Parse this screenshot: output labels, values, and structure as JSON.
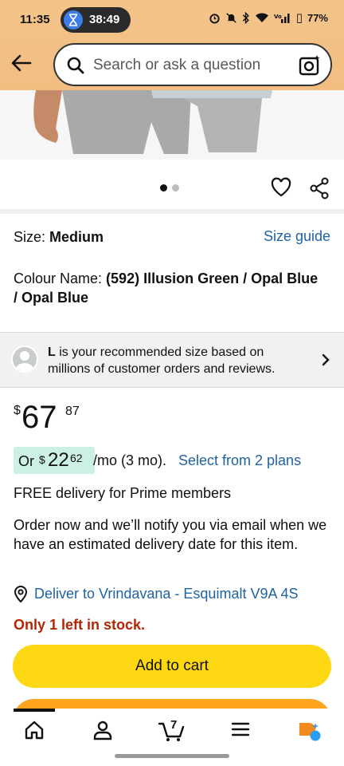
{
  "status_bar": {
    "time": "11:35",
    "timer": "38:49",
    "battery": "77%",
    "icons": [
      "alarm-icon",
      "mute-icon",
      "bluetooth-icon",
      "wifi-icon",
      "signal-icon",
      "battery-icon"
    ]
  },
  "search": {
    "placeholder": "Search or ask a question"
  },
  "gallery": {
    "dot_count": 2,
    "active_index": 0
  },
  "size": {
    "label": "Size: ",
    "value": "Medium",
    "guide_link": "Size guide"
  },
  "colour": {
    "label": "Colour Name: ",
    "value": "(592) Illusion Green / Opal Blue / Opal Blue"
  },
  "recommendation": {
    "size_letter": "L",
    "text": " is your recommended size based on millions of customer orders and reviews."
  },
  "price": {
    "currency": "$",
    "whole": "67",
    "fraction": "87"
  },
  "installment": {
    "prefix": "Or",
    "currency": "$",
    "whole": "22",
    "fraction": "62",
    "suffix": "/mo (3 mo).",
    "link": "Select from 2 plans"
  },
  "delivery": {
    "free_text": "FREE delivery for Prime members",
    "order_note": "Order now and we’ll notify you via email when we have an estimated delivery date for this item.",
    "deliver_to": "Deliver to Vrindavana - Esquimalt V9A 4S"
  },
  "stock": {
    "text": "Only 1 left in stock."
  },
  "actions": {
    "add_to_cart": "Add to cart"
  },
  "bottom_nav": {
    "cart_count": "7",
    "items": [
      "home-icon",
      "account-icon",
      "cart-icon",
      "menu-icon",
      "rufus-icon"
    ]
  },
  "colors": {
    "accent_link": "#2162a1",
    "cart_button": "#ffd814",
    "buy_button": "#ffa41c",
    "stock_red": "#b12704",
    "installment_badge": "#cdf0e6"
  }
}
